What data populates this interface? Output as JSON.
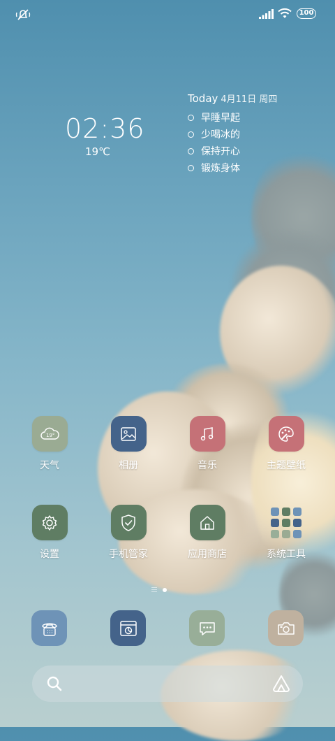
{
  "status_bar": {
    "battery": "100"
  },
  "clock": {
    "time": "02:36",
    "temperature": "19℃"
  },
  "todo_widget": {
    "title": "Today",
    "date": "4月11日 周四",
    "items": [
      "早睡早起",
      "少喝冰的",
      "保持开心",
      "锻炼身体"
    ]
  },
  "apps": [
    {
      "label": "天气",
      "icon": "weather-icon",
      "color": "#9aab93"
    },
    {
      "label": "相册",
      "icon": "gallery-icon",
      "color": "#44638a"
    },
    {
      "label": "音乐",
      "icon": "music-icon",
      "color": "#c57177"
    },
    {
      "label": "主题壁纸",
      "icon": "theme-palette-icon",
      "color": "#c57177"
    },
    {
      "label": "设置",
      "icon": "settings-icon",
      "color": "#5f7d63"
    },
    {
      "label": "手机管家",
      "icon": "security-shield-icon",
      "color": "#5f7d63"
    },
    {
      "label": "应用商店",
      "icon": "app-store-home-icon",
      "color": "#5f7d63"
    },
    {
      "label": "系统工具",
      "icon": "folder-grid-icon",
      "color": ""
    }
  ],
  "dock": [
    {
      "icon": "phone-icon",
      "color": "#6e93b7"
    },
    {
      "icon": "browser-icon",
      "color": "#44638a"
    },
    {
      "icon": "messages-icon",
      "color": "#98ae98"
    },
    {
      "icon": "camera-icon",
      "color": "#bfb19f"
    }
  ]
}
